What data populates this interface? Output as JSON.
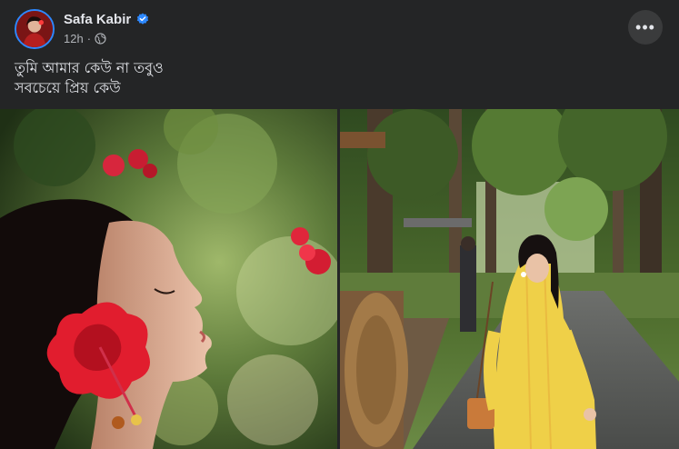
{
  "post": {
    "author_name": "Safa Kabir",
    "verified_icon": "verified-badge-icon",
    "timestamp": "12h",
    "separator": "·",
    "privacy_icon": "globe-icon",
    "more_label": "•••",
    "caption_lines": [
      "তুমি আমার কেউ না তবুও",
      "সবচেয়ে প্রিয় কেউ"
    ]
  },
  "colors": {
    "background": "#242526",
    "text_primary": "#e4e6eb",
    "text_secondary": "#b0b3b8",
    "verified_blue": "#2d88ff",
    "button_bg": "#3a3b3c"
  },
  "photos": [
    {
      "name": "photo-portrait-hibiscus"
    },
    {
      "name": "photo-yellow-kurta-path"
    }
  ]
}
